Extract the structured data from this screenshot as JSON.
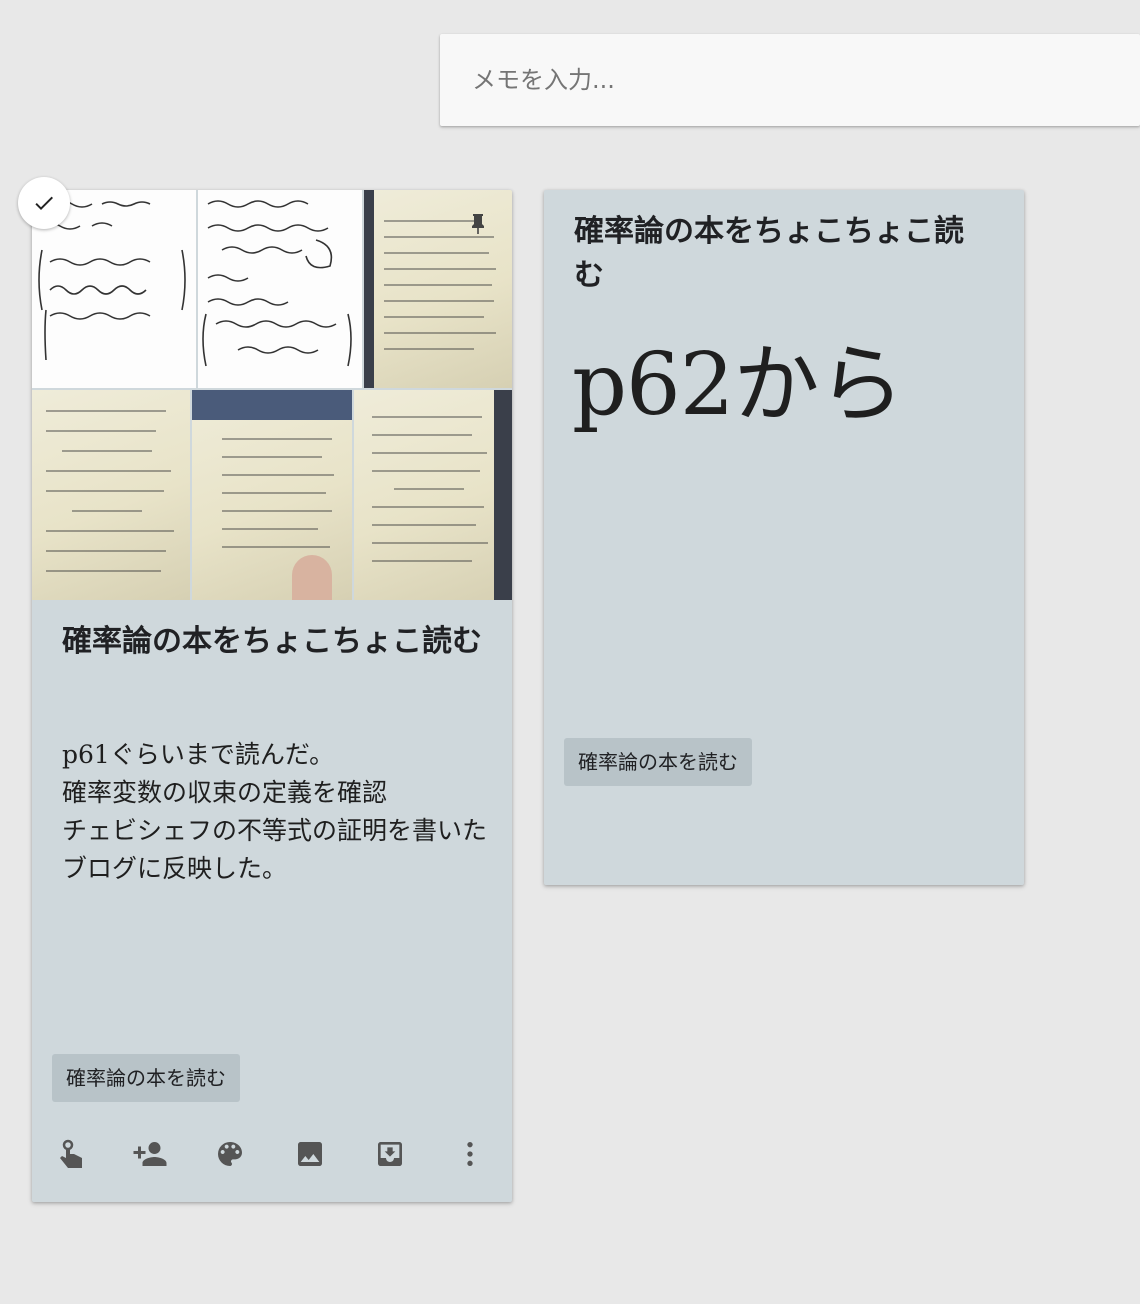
{
  "memo_input": {
    "placeholder": "メモを入力..."
  },
  "notes": [
    {
      "title": "確率論の本をちょこちょこ読む",
      "body": "p61ぐらいまで読んだ。\n確率変数の収束の定義を確認\nチェビシェフの不等式の証明を書いた\nブログに反映した。",
      "label": "確率論の本を読む",
      "selected": true,
      "background_color": "#cfd8dc",
      "image_count": 6,
      "toolbar_icons": [
        "remind-me-icon",
        "collaborator-icon",
        "palette-icon",
        "add-image-icon",
        "archive-icon",
        "more-vert-icon"
      ]
    },
    {
      "title": "確率論の本をちょこちょこ読む",
      "body": "p62から",
      "label": "確率論の本を読む",
      "background_color": "#cfd8dc"
    }
  ],
  "colors": {
    "page_background": "#e8e8e8",
    "note_background": "#cfd8dc",
    "label_chip": "#b8c3c8"
  }
}
